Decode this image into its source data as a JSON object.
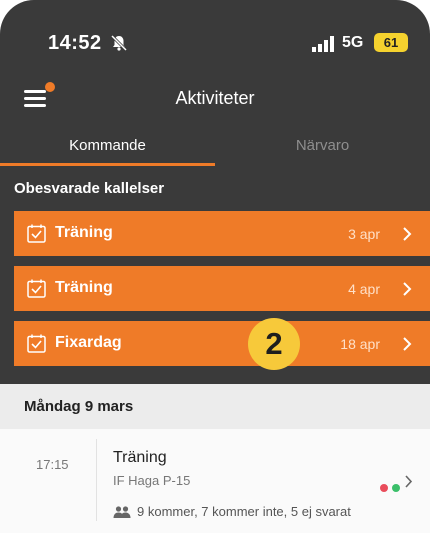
{
  "status_bar": {
    "time": "14:52",
    "network": "5G",
    "battery": "61"
  },
  "header": {
    "title": "Aktiviteter"
  },
  "tabs": [
    {
      "label": "Kommande",
      "active": true
    },
    {
      "label": "Närvaro",
      "active": false
    }
  ],
  "unanswered": {
    "heading": "Obesvarade kallelser",
    "items": [
      {
        "label": "Träning",
        "date": "3 apr"
      },
      {
        "label": "Träning",
        "date": "4 apr"
      },
      {
        "label": "Fixardag",
        "date": "18 apr"
      }
    ]
  },
  "annotation_badge": "2",
  "day": {
    "heading": "Måndag 9 mars",
    "event": {
      "time": "17:15",
      "title": "Träning",
      "team": "IF Haga P-15",
      "counts": "9 kommer, 7 kommer inte, 5 ej svarat",
      "dot_colors": [
        "#e94c5b",
        "#3bbf6a"
      ]
    }
  },
  "colors": {
    "accent": "#ef7b28",
    "header_bg": "#3a3a3a"
  }
}
